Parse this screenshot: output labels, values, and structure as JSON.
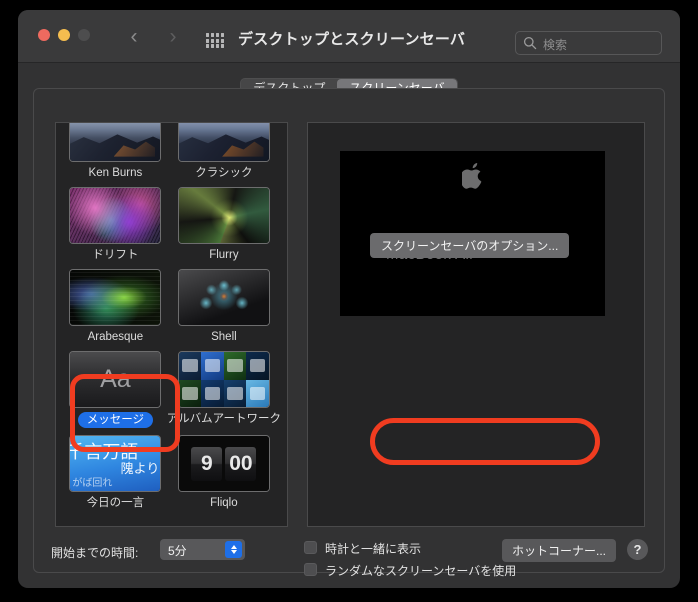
{
  "window": {
    "title": "デスクトップとスクリーンセーバ",
    "traffic_lights": [
      "close",
      "minimize",
      "zoom"
    ],
    "nav_back": "‹",
    "nav_forward": "›",
    "grid_icon": "grid-icon"
  },
  "search": {
    "placeholder": "検索",
    "icon": "search-icon"
  },
  "tabs": [
    {
      "label": "デスクトップ",
      "active": false
    },
    {
      "label": "スクリーンセーバ",
      "active": true
    }
  ],
  "screensavers": [
    {
      "label": "Ken Burns",
      "art": "mountain",
      "selected": false
    },
    {
      "label": "クラシック",
      "art": "classic",
      "selected": false
    },
    {
      "label": "ドリフト",
      "art": "drift",
      "selected": false
    },
    {
      "label": "Flurry",
      "art": "flurry",
      "selected": false
    },
    {
      "label": "Arabesque",
      "art": "arabesque",
      "selected": false
    },
    {
      "label": "Shell",
      "art": "shell",
      "selected": false
    },
    {
      "label": "メッセージ",
      "art": "aa",
      "selected": true
    },
    {
      "label": "アルバムアートワーク",
      "art": "album",
      "selected": false
    },
    {
      "label": "今日の一言",
      "art": "quote",
      "selected": false
    },
    {
      "label": "Fliqlo",
      "art": "fliqlo",
      "selected": false
    }
  ],
  "quote_thumb": {
    "line1": "千言万語",
    "line2": "隗より",
    "line3": "がば回れ"
  },
  "fliqlo_thumb": {
    "hours": "9",
    "minutes": "00"
  },
  "preview": {
    "apple_logo": "",
    "machine_name": "MacBook Air"
  },
  "options_button": {
    "label": "スクリーンセーバのオプション..."
  },
  "bottom": {
    "start_after_label": "開始までの時間:",
    "start_after_value": "5分",
    "checkbox_clock": {
      "label": "時計と一緒に表示",
      "checked": false
    },
    "checkbox_random": {
      "label": "ランダムなスクリーンセーバを使用",
      "checked": false
    },
    "hot_corners_label": "ホットコーナー...",
    "help_label": "?"
  },
  "annotations": {
    "highlight_message_item": "rounded-rect",
    "highlight_options_button": "ellipse",
    "color": "#f03c20"
  }
}
